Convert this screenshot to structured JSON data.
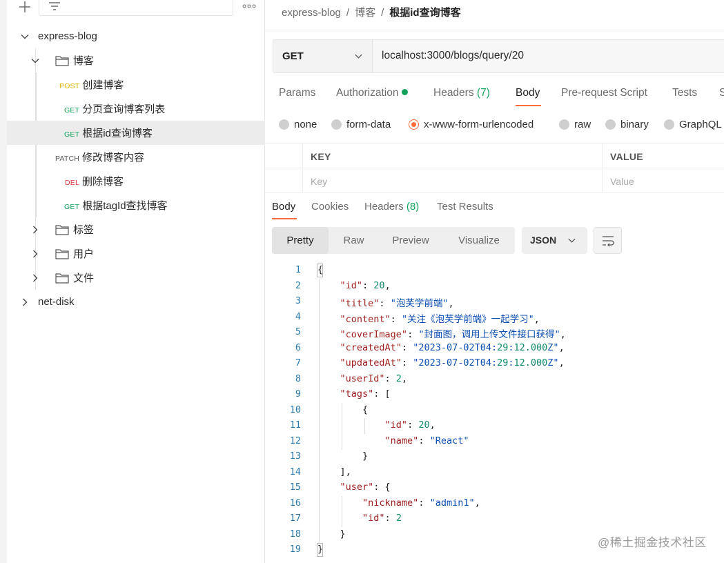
{
  "sidebar": {
    "tree": [
      {
        "label": "express-blog",
        "expanded": true
      },
      {
        "label": "博客",
        "expanded": true
      },
      {
        "method": "POST",
        "label": "创建博客"
      },
      {
        "method": "GET",
        "label": "分页查询博客列表"
      },
      {
        "method": "GET",
        "label": "根据id查询博客",
        "selected": true
      },
      {
        "method": "PATCH",
        "label": "修改博客内容"
      },
      {
        "method": "DEL",
        "label": "删除博客"
      },
      {
        "method": "GET",
        "label": "根据tagId查找博客"
      },
      {
        "label": "标签",
        "expanded": false
      },
      {
        "label": "用户",
        "expanded": false
      },
      {
        "label": "文件",
        "expanded": false
      },
      {
        "label": "net-disk",
        "expanded": false
      }
    ]
  },
  "breadcrumb": [
    "express-blog",
    "博客",
    "根据id查询博客"
  ],
  "request": {
    "method": "GET",
    "url": "localhost:3000/blogs/query/20"
  },
  "request_tabs": [
    {
      "label": "Params"
    },
    {
      "label": "Authorization"
    },
    {
      "label": "Headers",
      "count": "(7)"
    },
    {
      "label": "Body",
      "active": true
    },
    {
      "label": "Pre-request Script"
    },
    {
      "label": "Tests"
    },
    {
      "label": "S"
    }
  ],
  "body_types": [
    {
      "label": "none"
    },
    {
      "label": "form-data"
    },
    {
      "label": "x-www-form-urlencoded",
      "selected": true
    },
    {
      "label": "raw"
    },
    {
      "label": "binary"
    },
    {
      "label": "GraphQL"
    }
  ],
  "kv_table": {
    "headers": [
      "KEY",
      "VALUE"
    ],
    "placeholders": [
      "Key",
      "Value"
    ]
  },
  "response_tabs": [
    {
      "label": "Body",
      "active": true
    },
    {
      "label": "Cookies"
    },
    {
      "label": "Headers",
      "count": "(8)"
    },
    {
      "label": "Test Results"
    }
  ],
  "view_modes": [
    "Pretty",
    "Raw",
    "Preview",
    "Visualize"
  ],
  "format": "JSON",
  "code_lines": [
    "{",
    "    \"id\": 20,",
    "    \"title\": \"泡芙学前端\",",
    "    \"content\": \"关注《泡芙学前端》一起学习\",",
    "    \"coverImage\": \"封面图，调用上传文件接口获得\",",
    "    \"createdAt\": \"2023-07-02T04:29:12.000Z\",",
    "    \"updatedAt\": \"2023-07-02T04:29:12.000Z\",",
    "    \"userId\": 2,",
    "    \"tags\": [",
    "        {",
    "            \"id\": 20,",
    "            \"name\": \"React\"",
    "        }",
    "    ],",
    "    \"user\": {",
    "        \"nickname\": \"admin1\",",
    "        \"id\": 2",
    "    }",
    "}"
  ],
  "watermark": "@稀土掘金技术社区",
  "colors": {
    "accent": "#ff6c37",
    "get": "#12a15a",
    "post": "#e4b400",
    "delete": "#d93b3b",
    "json_key": "#a11f1f",
    "json_string": "#0b4fb3",
    "json_number": "#0f8a6b"
  }
}
